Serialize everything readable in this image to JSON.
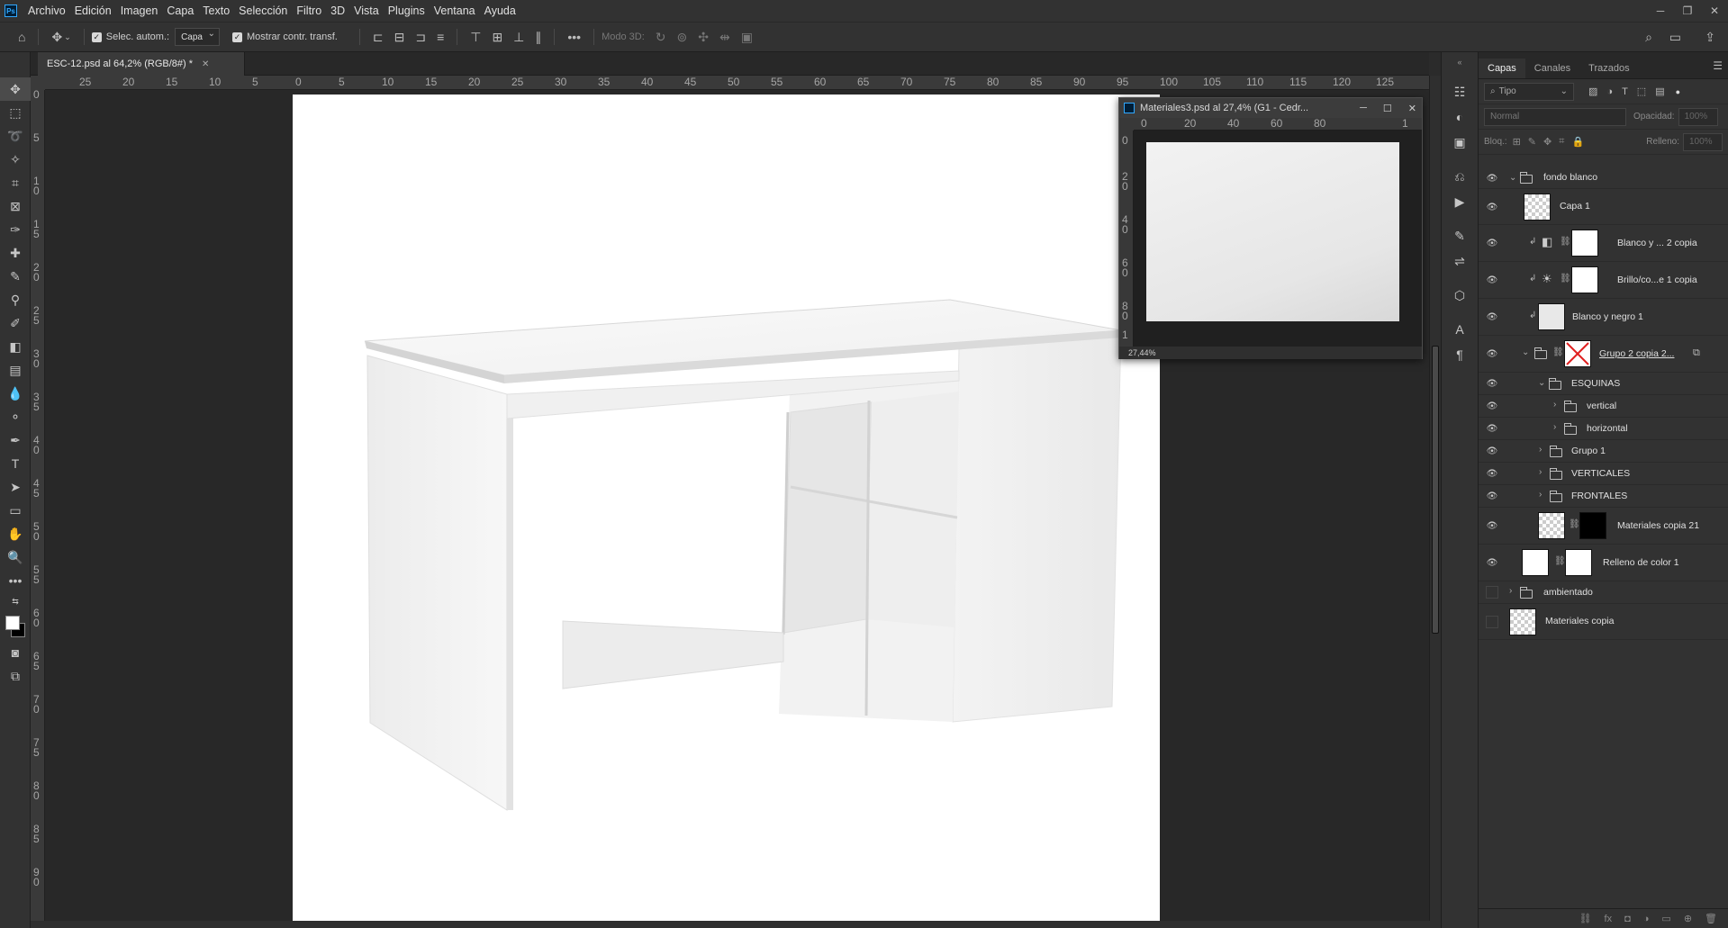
{
  "menu": {
    "logo": "Ps",
    "items": [
      "Archivo",
      "Edición",
      "Imagen",
      "Capa",
      "Texto",
      "Selección",
      "Filtro",
      "3D",
      "Vista",
      "Plugins",
      "Ventana",
      "Ayuda"
    ]
  },
  "options_bar": {
    "auto_select_label": "Selec. autom.:",
    "auto_select_value": "Capa",
    "show_transform_label": "Mostrar contr. transf.",
    "mode_3d_label": "Modo 3D:"
  },
  "document": {
    "tab_title": "ESC-12.psd al 64,2% (RGB/8#) *",
    "ruler_top": [
      "25",
      "20",
      "15",
      "10",
      "5",
      "0",
      "5",
      "10",
      "15",
      "20",
      "25",
      "30",
      "35",
      "40",
      "45",
      "50",
      "55",
      "60",
      "65",
      "70",
      "75",
      "80",
      "85",
      "90",
      "95",
      "100",
      "105",
      "110",
      "115",
      "120",
      "125"
    ],
    "ruler_left": [
      "0",
      "5",
      "1\n0",
      "1\n5",
      "2\n0",
      "2\n5",
      "3\n0",
      "3\n5",
      "4\n0",
      "4\n5",
      "5\n0",
      "5\n5",
      "6\n0",
      "6\n5",
      "7\n0",
      "7\n5",
      "8\n0",
      "8\n5",
      "9\n0"
    ]
  },
  "floating_window": {
    "title": "Materiales3.psd al 27,4% (G1 - Cedr...",
    "ruler_top": [
      "0",
      "20",
      "40",
      "60",
      "80",
      "1"
    ],
    "ruler_left": [
      "0",
      "2\n0",
      "4\n0",
      "6\n0",
      "8\n0",
      "1"
    ],
    "zoom": "27,44%"
  },
  "layers_panel": {
    "tabs": [
      "Capas",
      "Canales",
      "Trazados"
    ],
    "filter_kind": "Tipo",
    "blend_mode": "Normal",
    "opacity_label": "Opacidad:",
    "opacity_value": "100%",
    "lock_label": "Bloq.:",
    "fill_label": "Relleno:",
    "fill_value": "100%",
    "layers": [
      {
        "name": "fondo blanco",
        "type": "group",
        "visible": true
      },
      {
        "name": "Capa 1",
        "type": "layer",
        "visible": true
      },
      {
        "name": "Blanco y ... 2 copia",
        "type": "adjustment",
        "visible": true
      },
      {
        "name": "Brillo/co...e 1 copia",
        "type": "adjustment",
        "visible": true
      },
      {
        "name": "Blanco y negro 1",
        "type": "smart",
        "visible": true
      },
      {
        "name": "Grupo 2 copia 2...",
        "type": "group",
        "visible": true
      },
      {
        "name": "ESQUINAS",
        "type": "group",
        "visible": true
      },
      {
        "name": "vertical",
        "type": "group",
        "visible": true
      },
      {
        "name": "horizontal",
        "type": "group",
        "visible": true
      },
      {
        "name": "Grupo 1",
        "type": "group",
        "visible": true
      },
      {
        "name": "VERTICALES",
        "type": "group",
        "visible": true
      },
      {
        "name": "FRONTALES",
        "type": "group",
        "visible": true
      },
      {
        "name": "Materiales copia 21",
        "type": "smart",
        "visible": true
      },
      {
        "name": "Relleno de color 1",
        "type": "fill",
        "visible": true
      },
      {
        "name": "ambientado",
        "type": "group",
        "visible": false
      },
      {
        "name": "Materiales copia",
        "type": "smart",
        "visible": false
      }
    ]
  },
  "colors": {
    "bg_dark": "#282828",
    "panel": "#323232",
    "accent": "#31a8ff"
  }
}
